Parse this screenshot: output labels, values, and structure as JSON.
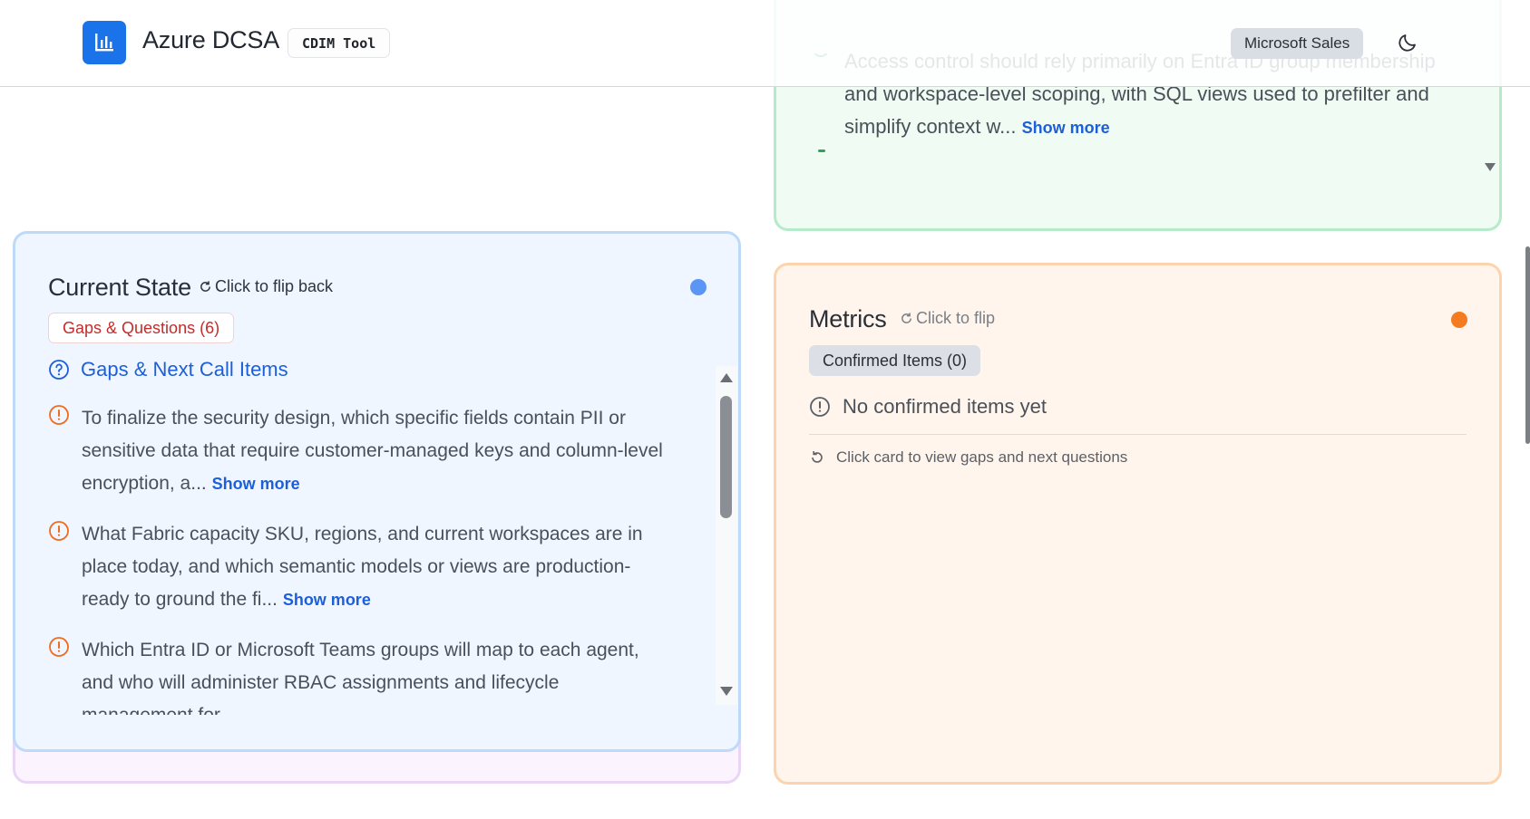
{
  "header": {
    "app_title": "Azure DCSA",
    "tool_badge": "CDIM Tool",
    "org_badge": "Microsoft Sales",
    "logo_icon": "bar-chart-icon",
    "theme_icon": "moon-icon"
  },
  "green_card": {
    "text": "Access control should rely primarily on Entra ID group membership and workspace-level scoping, with SQL views used to prefilter and simplify context w...",
    "show_more": "Show more"
  },
  "current_state_card": {
    "title": "Current State",
    "flip_hint": "Click to flip back",
    "pill": "Gaps & Questions (6)",
    "section_title": "Gaps & Next Call Items",
    "status_color": "#5b96f7",
    "items": [
      {
        "text": "To finalize the security design, which specific fields contain PII or sensitive data that require customer-managed keys and column-level encryption, a...",
        "show_more": "Show more"
      },
      {
        "text": "What Fabric capacity SKU, regions, and current workspaces are in place today, and which semantic models or views are production-ready to ground the fi...",
        "show_more": "Show more"
      },
      {
        "text": "Which Entra ID or Microsoft Teams groups will map to each agent, and who will administer RBAC assignments and lifecycle management for",
        "show_more": ""
      }
    ]
  },
  "metrics_card": {
    "title": "Metrics",
    "flip_hint": "Click to flip",
    "pill": "Confirmed Items (0)",
    "empty_text": "No confirmed items yet",
    "footer_text": "Click card to view gaps and next questions",
    "status_color": "#f47b20"
  }
}
